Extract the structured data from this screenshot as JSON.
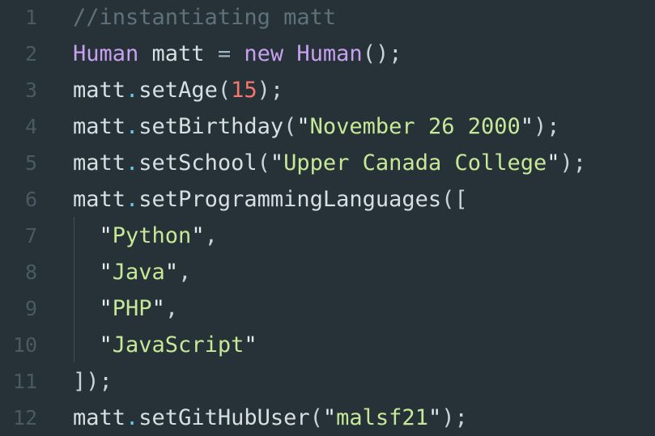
{
  "editor": {
    "colors": {
      "background": "#263238",
      "gutter": "#4a5a63",
      "comment": "#5f717b",
      "keyword": "#c8a0f0",
      "dot": "#62c8e8",
      "number": "#f7766d",
      "string": "#c7e897",
      "text": "#d6dfe4"
    },
    "lines": [
      {
        "num": "1",
        "tokens": [
          {
            "t": "//instantiating matt",
            "c": "tok-comment"
          }
        ]
      },
      {
        "num": "2",
        "tokens": [
          {
            "t": "Human",
            "c": "tok-type"
          },
          {
            "t": " matt ",
            "c": "tok-var"
          },
          {
            "t": "=",
            "c": "tok-op"
          },
          {
            "t": " ",
            "c": "tok-punct"
          },
          {
            "t": "new",
            "c": "tok-keyword"
          },
          {
            "t": " ",
            "c": "tok-punct"
          },
          {
            "t": "Human",
            "c": "tok-type"
          },
          {
            "t": "();",
            "c": "tok-punct"
          }
        ]
      },
      {
        "num": "3",
        "tokens": [
          {
            "t": "matt",
            "c": "tok-var"
          },
          {
            "t": ".",
            "c": "tok-dot"
          },
          {
            "t": "setAge",
            "c": "tok-method"
          },
          {
            "t": "(",
            "c": "tok-punct"
          },
          {
            "t": "15",
            "c": "tok-number"
          },
          {
            "t": ");",
            "c": "tok-punct"
          }
        ]
      },
      {
        "num": "4",
        "tokens": [
          {
            "t": "matt",
            "c": "tok-var"
          },
          {
            "t": ".",
            "c": "tok-dot"
          },
          {
            "t": "setBirthday",
            "c": "tok-method"
          },
          {
            "t": "(",
            "c": "tok-punct"
          },
          {
            "t": "\"",
            "c": "tok-quote"
          },
          {
            "t": "November 26 2000",
            "c": "tok-string"
          },
          {
            "t": "\"",
            "c": "tok-quote"
          },
          {
            "t": ");",
            "c": "tok-punct"
          }
        ]
      },
      {
        "num": "5",
        "tokens": [
          {
            "t": "matt",
            "c": "tok-var"
          },
          {
            "t": ".",
            "c": "tok-dot"
          },
          {
            "t": "setSchool",
            "c": "tok-method"
          },
          {
            "t": "(",
            "c": "tok-punct"
          },
          {
            "t": "\"",
            "c": "tok-quote"
          },
          {
            "t": "Upper Canada College",
            "c": "tok-string"
          },
          {
            "t": "\"",
            "c": "tok-quote"
          },
          {
            "t": ");",
            "c": "tok-punct"
          }
        ]
      },
      {
        "num": "6",
        "tokens": [
          {
            "t": "matt",
            "c": "tok-var"
          },
          {
            "t": ".",
            "c": "tok-dot"
          },
          {
            "t": "setProgrammingLanguages",
            "c": "tok-method"
          },
          {
            "t": "([",
            "c": "tok-punct"
          }
        ]
      },
      {
        "num": "7",
        "tokens": [
          {
            "t": "  ",
            "c": "tok-punct"
          },
          {
            "t": "\"",
            "c": "tok-quote"
          },
          {
            "t": "Python",
            "c": "tok-string"
          },
          {
            "t": "\"",
            "c": "tok-quote"
          },
          {
            "t": ",",
            "c": "tok-punct"
          }
        ]
      },
      {
        "num": "8",
        "tokens": [
          {
            "t": "  ",
            "c": "tok-punct"
          },
          {
            "t": "\"",
            "c": "tok-quote"
          },
          {
            "t": "Java",
            "c": "tok-string"
          },
          {
            "t": "\"",
            "c": "tok-quote"
          },
          {
            "t": ",",
            "c": "tok-punct"
          }
        ]
      },
      {
        "num": "9",
        "tokens": [
          {
            "t": "  ",
            "c": "tok-punct"
          },
          {
            "t": "\"",
            "c": "tok-quote"
          },
          {
            "t": "PHP",
            "c": "tok-string"
          },
          {
            "t": "\"",
            "c": "tok-quote"
          },
          {
            "t": ",",
            "c": "tok-punct"
          }
        ]
      },
      {
        "num": "10",
        "tokens": [
          {
            "t": "  ",
            "c": "tok-punct"
          },
          {
            "t": "\"",
            "c": "tok-quote"
          },
          {
            "t": "JavaScript",
            "c": "tok-string"
          },
          {
            "t": "\"",
            "c": "tok-quote"
          }
        ]
      },
      {
        "num": "11",
        "tokens": [
          {
            "t": "]);",
            "c": "tok-punct"
          }
        ]
      },
      {
        "num": "12",
        "tokens": [
          {
            "t": "matt",
            "c": "tok-var"
          },
          {
            "t": ".",
            "c": "tok-dot"
          },
          {
            "t": "setGitHubUser",
            "c": "tok-method"
          },
          {
            "t": "(",
            "c": "tok-punct"
          },
          {
            "t": "\"",
            "c": "tok-quote"
          },
          {
            "t": "malsf21",
            "c": "tok-string"
          },
          {
            "t": "\"",
            "c": "tok-quote"
          },
          {
            "t": ");",
            "c": "tok-punct"
          }
        ]
      }
    ]
  }
}
